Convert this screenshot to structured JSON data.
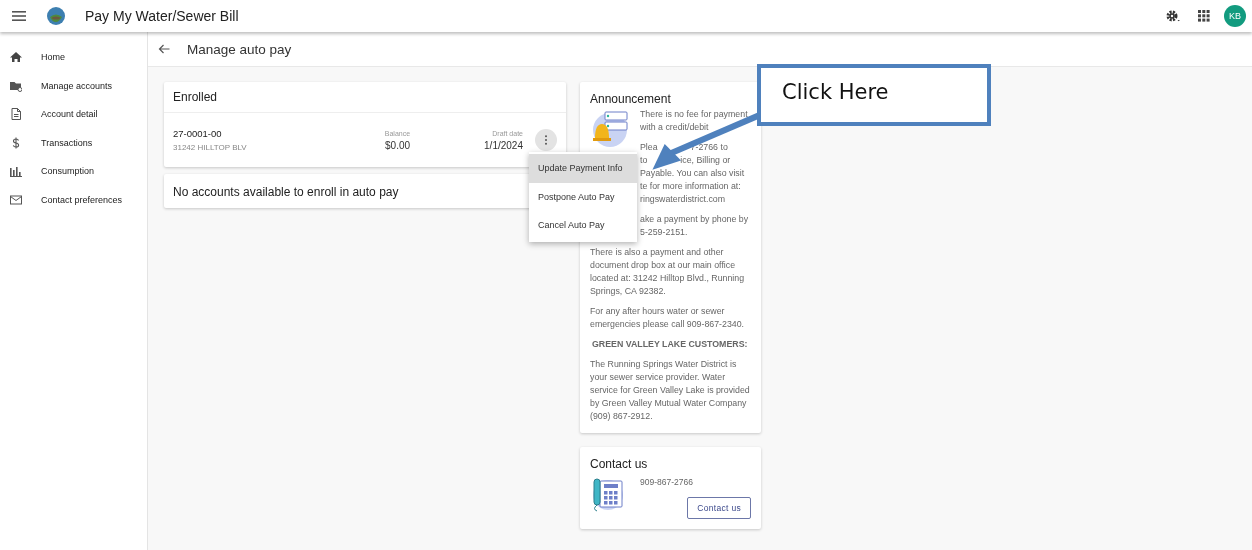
{
  "header": {
    "title": "Pay My Water/Sewer Bill",
    "avatar": "KB"
  },
  "sidebar": {
    "items": [
      {
        "label": "Home"
      },
      {
        "label": "Manage accounts"
      },
      {
        "label": "Account detail"
      },
      {
        "label": "Transactions"
      },
      {
        "label": "Consumption"
      },
      {
        "label": "Contact preferences"
      }
    ]
  },
  "page_title": "Manage auto pay",
  "enrolled": {
    "title": "Enrolled",
    "account": {
      "number": "27-0001-00",
      "address": "31242 HILLTOP BLV",
      "balance_label": "Balance",
      "balance": "$0.00",
      "draft_label": "Draft date",
      "draft_date": "1/1/2024"
    }
  },
  "no_accounts": {
    "title": "No accounts available to enroll in auto pay"
  },
  "menu": {
    "items": [
      {
        "label": "Update Payment Info",
        "selected": true
      },
      {
        "label": "Postpone Auto Pay",
        "selected": false
      },
      {
        "label": "Cancel Auto Pay",
        "selected": false
      }
    ]
  },
  "announcement": {
    "title": "Announcement",
    "partial_paragraphs": [
      {
        "lines": [
          {
            "fragments": [
              "There is no fee for payment"
            ]
          },
          {
            "fragments": [
              "with a credit/debit"
            ]
          }
        ]
      },
      {
        "lines": [
          {
            "fragments": [
              "Plea",
              "7-2766 to"
            ]
          },
          {
            "fragments": [
              "to",
              "ice, Billing or"
            ]
          },
          {
            "fragments": [
              "Payable. You can also visit"
            ]
          },
          {
            "fragments": [
              "te for more information at:"
            ]
          },
          {
            "fragments": [
              "ringswaterdistrict.com"
            ]
          }
        ]
      },
      {
        "lines": [
          {
            "fragments": [
              "ake a payment by phone by"
            ]
          },
          {
            "fragments": [
              "5-259-2151."
            ]
          }
        ]
      }
    ],
    "paragraphs": [
      {
        "kind": "text",
        "text": "There is also a payment and other document drop box at our main office located at: 31242 Hilltop Blvd., Running Springs, CA 92382."
      },
      {
        "kind": "text",
        "text": "For any after hours water or sewer emergencies please call 909-867-2340."
      },
      {
        "kind": "heading",
        "text": "GREEN VALLEY LAKE CUSTOMERS:"
      },
      {
        "kind": "text",
        "text": "The Running Springs Water District is your sewer service provider. Water service for Green Valley Lake is provided by Green Valley Mutual Water Company (909) 867-2912."
      }
    ]
  },
  "contact": {
    "title": "Contact us",
    "phone": "909-867-2766",
    "button": "Contact us"
  },
  "callout": {
    "text": "Click Here"
  }
}
